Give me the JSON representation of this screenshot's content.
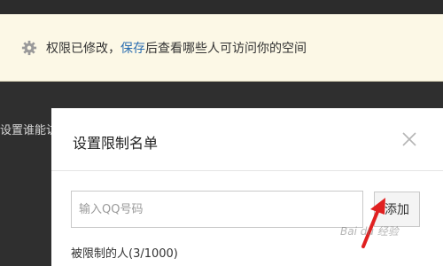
{
  "notice": {
    "prefix": "权限已修改，",
    "link": "保存",
    "suffix": "后查看哪些人可访问你的空间",
    "icon": "gear-icon"
  },
  "background_label": "设置谁能访",
  "dialog": {
    "title": "设置限制名单",
    "close_icon": "close-icon",
    "input_placeholder": "输入QQ号码",
    "add_button": "添加",
    "restricted_label": "被限制的人(3/1000)"
  },
  "watermark": "Bai du 经验",
  "colors": {
    "notice_bg": "#fcf8e6",
    "link": "#2a6db0",
    "arrow": "#e02020",
    "backdrop": "#2f2f2f"
  }
}
